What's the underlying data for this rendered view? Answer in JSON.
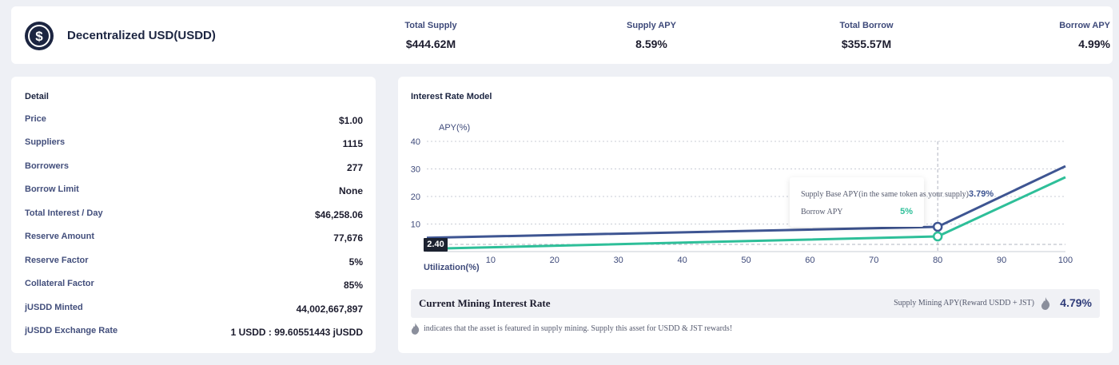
{
  "asset": {
    "name": "Decentralized USD(USDD)"
  },
  "stats": [
    {
      "label": "Total Supply",
      "value": "$444.62M"
    },
    {
      "label": "Supply APY",
      "value": "8.59%"
    },
    {
      "label": "Total Borrow",
      "value": "$355.57M"
    },
    {
      "label": "Borrow APY",
      "value": "4.99%"
    }
  ],
  "detail": {
    "title": "Detail",
    "rows": [
      {
        "label": "Price",
        "value": "$1.00"
      },
      {
        "label": "Suppliers",
        "value": "1115"
      },
      {
        "label": "Borrowers",
        "value": "277"
      },
      {
        "label": "Borrow Limit",
        "value": "None"
      },
      {
        "label": "Total Interest / Day",
        "value": "$46,258.06"
      },
      {
        "label": "Reserve Amount",
        "value": "77,676"
      },
      {
        "label": "Reserve Factor",
        "value": "5%"
      },
      {
        "label": "Collateral Factor",
        "value": "85%"
      },
      {
        "label": "jUSDD Minted",
        "value": "44,002,667,897"
      },
      {
        "label": "jUSDD Exchange Rate",
        "value": "1 USDD : 99.60551443 jUSDD"
      }
    ]
  },
  "irm": {
    "title": "Interest Rate Model",
    "tooltip": {
      "supply_label": "Supply Base APY(in the same token as your supply)",
      "supply_value": "3.79%",
      "borrow_label": "Borrow APY",
      "borrow_value": "5%"
    },
    "crosshair_y_label": "2.40",
    "mining": {
      "title": "Current Mining Interest Rate",
      "label": "Supply Mining APY(Reward USDD + JST)",
      "value": "4.79%",
      "icon": "flame-icon"
    },
    "footnote": "indicates that the asset is featured in supply mining. Supply this asset for USDD & JST rewards!"
  },
  "colors": {
    "supply": "#3e5592",
    "borrow": "#2ebf99",
    "accent": "#2f3c79"
  },
  "chart_data": {
    "type": "line",
    "ylabel": "APY(%)",
    "xlabel": "Utilization(%)",
    "ylim": [
      0,
      40
    ],
    "xlim": [
      0,
      100
    ],
    "yticks": [
      10,
      20,
      30,
      40
    ],
    "xticks": [
      10,
      20,
      30,
      40,
      50,
      60,
      70,
      80,
      90,
      100
    ],
    "grid": true,
    "cursor_x": 80,
    "series": [
      {
        "name": "Supply Base APY(in the same token as your supply)",
        "x": [
          0,
          80,
          100
        ],
        "y": [
          5,
          9,
          31
        ],
        "color": "#3e5592"
      },
      {
        "name": "Borrow APY",
        "x": [
          0,
          80,
          100
        ],
        "y": [
          1,
          5.5,
          27
        ],
        "color": "#2ebf99"
      }
    ]
  }
}
